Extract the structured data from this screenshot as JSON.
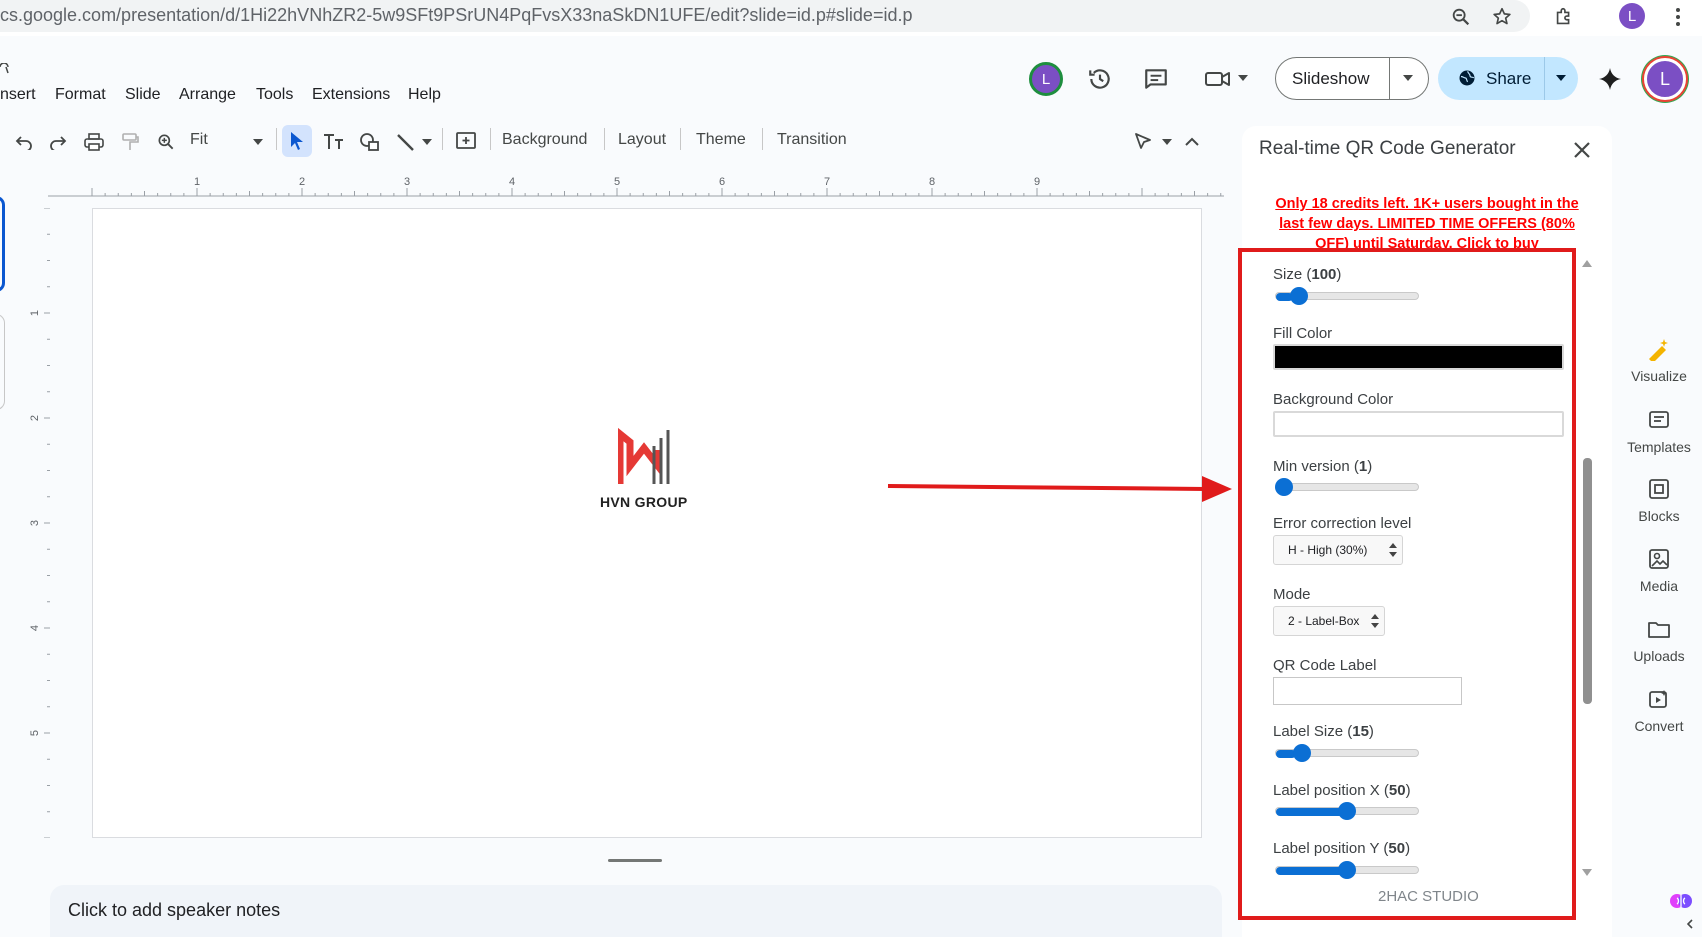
{
  "browser": {
    "url": "cs.google.com/presentation/d/1Hi22hVNhZR2-5w9SFt9PSrUN4PqFvsX33naSkDN1UFE/edit?slide=id.p#slide=id.p",
    "profile_initial": "L",
    "icons": [
      "zoom-icon",
      "bookmark-star-icon",
      "extensions-icon",
      "kebab-menu-icon"
    ]
  },
  "menu": [
    "nsert",
    "Format",
    "Slide",
    "Arrange",
    "Tools",
    "Extensions",
    "Help"
  ],
  "header": {
    "avatar_initial": "L",
    "slideshow_label": "Slideshow",
    "share_label": "Share",
    "account_initial": "L"
  },
  "toolbar": {
    "zoom_value": "Fit",
    "background_label": "Background",
    "layout_label": "Layout",
    "theme_label": "Theme",
    "transition_label": "Transition"
  },
  "ruler": {
    "h_ticks": [
      "1",
      "2",
      "3",
      "4",
      "5",
      "6",
      "7",
      "8",
      "9"
    ],
    "v_ticks": [
      "1",
      "2",
      "3",
      "4",
      "5"
    ]
  },
  "slide": {
    "logo_text": "HVN GROUP"
  },
  "notes": {
    "placeholder": "Click to add speaker notes"
  },
  "panel": {
    "title": "Real-time QR Code Generator",
    "promo": "Only 18 credits left. 1K+ users bought in the last few days. LIMITED TIME OFFERS (80% OFF) until Saturday. Click to buy",
    "size": {
      "label": "Size",
      "value": "100",
      "fraction": 0.12
    },
    "fill_color": {
      "label": "Fill Color",
      "color": "#000000"
    },
    "background_color": {
      "label": "Background Color",
      "color": "#ffffff"
    },
    "min_version": {
      "label": "Min version",
      "value": "1",
      "fraction": 0.0
    },
    "error_correction": {
      "label": "Error correction level",
      "selected": "H - High (30%)"
    },
    "mode": {
      "label": "Mode",
      "selected": "2 - Label-Box"
    },
    "qr_label": {
      "label": "QR Code Label",
      "value": ""
    },
    "label_size": {
      "label": "Label Size",
      "value": "15",
      "fraction": 0.14
    },
    "label_pos_x": {
      "label": "Label position X",
      "value": "50",
      "fraction": 0.5
    },
    "label_pos_y": {
      "label": "Label position Y",
      "value": "50",
      "fraction": 0.5
    },
    "footer": "2HAC STUDIO"
  },
  "rail": [
    {
      "label": "Visualize",
      "icon": "visualize-icon"
    },
    {
      "label": "Templates",
      "icon": "templates-icon"
    },
    {
      "label": "Blocks",
      "icon": "blocks-icon"
    },
    {
      "label": "Media",
      "icon": "media-icon"
    },
    {
      "label": "Uploads",
      "icon": "uploads-icon"
    },
    {
      "label": "Convert",
      "icon": "convert-icon"
    }
  ],
  "colors": {
    "accent_blue": "#0b6fd4",
    "highlight_red": "#e01b1b",
    "share_bg": "#c2e7ff"
  }
}
